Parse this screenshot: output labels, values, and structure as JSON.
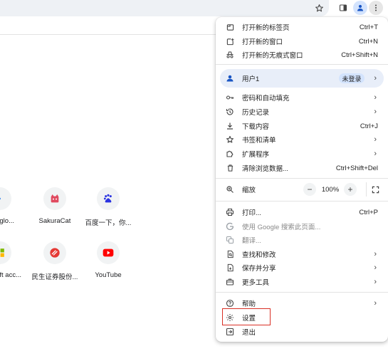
{
  "toolbar": {
    "icons": [
      "star-icon",
      "side-panel-icon",
      "profile-icon",
      "more-vert-icon"
    ]
  },
  "shortcuts": [
    {
      "label": "rk glo...",
      "icon": "partial-icon"
    },
    {
      "label": "SakuraCat",
      "icon": "sakuracat-icon"
    },
    {
      "label": "百度一下，你...",
      "icon": "baidu-icon"
    },
    {
      "label": "oft acc...",
      "icon": "microsoft-icon"
    },
    {
      "label": "民生证券股份...",
      "icon": "minsheng-icon"
    },
    {
      "label": "YouTube",
      "icon": "youtube-icon"
    }
  ],
  "menu": {
    "new_tab": {
      "label": "打开新的标签页",
      "shortcut": "Ctrl+T"
    },
    "new_window": {
      "label": "打开新的窗口",
      "shortcut": "Ctrl+N"
    },
    "incognito": {
      "label": "打开新的无痕式窗口",
      "shortcut": "Ctrl+Shift+N"
    },
    "profile": {
      "label": "用户1",
      "badge": "未登录"
    },
    "passwords": {
      "label": "密码和自动填充"
    },
    "history": {
      "label": "历史记录"
    },
    "downloads": {
      "label": "下载内容",
      "shortcut": "Ctrl+J"
    },
    "bookmarks": {
      "label": "书签和清单"
    },
    "extensions": {
      "label": "扩展程序"
    },
    "clear_data": {
      "label": "清除浏览数据...",
      "shortcut": "Ctrl+Shift+Del"
    },
    "zoom": {
      "label": "缩放",
      "minus": "−",
      "value": "100%",
      "plus": "+"
    },
    "print": {
      "label": "打印...",
      "shortcut": "Ctrl+P"
    },
    "google_search": {
      "label": "使用 Google 搜索此页面..."
    },
    "translate": {
      "label": "翻译..."
    },
    "find": {
      "label": "查找和修改"
    },
    "save_share": {
      "label": "保存并分享"
    },
    "more_tools": {
      "label": "更多工具"
    },
    "help": {
      "label": "帮助"
    },
    "settings": {
      "label": "设置"
    },
    "exit": {
      "label": "退出"
    }
  },
  "colors": {
    "accent": "#1a73e8",
    "highlight_border": "#d93025",
    "profile_bg": "#e8eef9"
  }
}
